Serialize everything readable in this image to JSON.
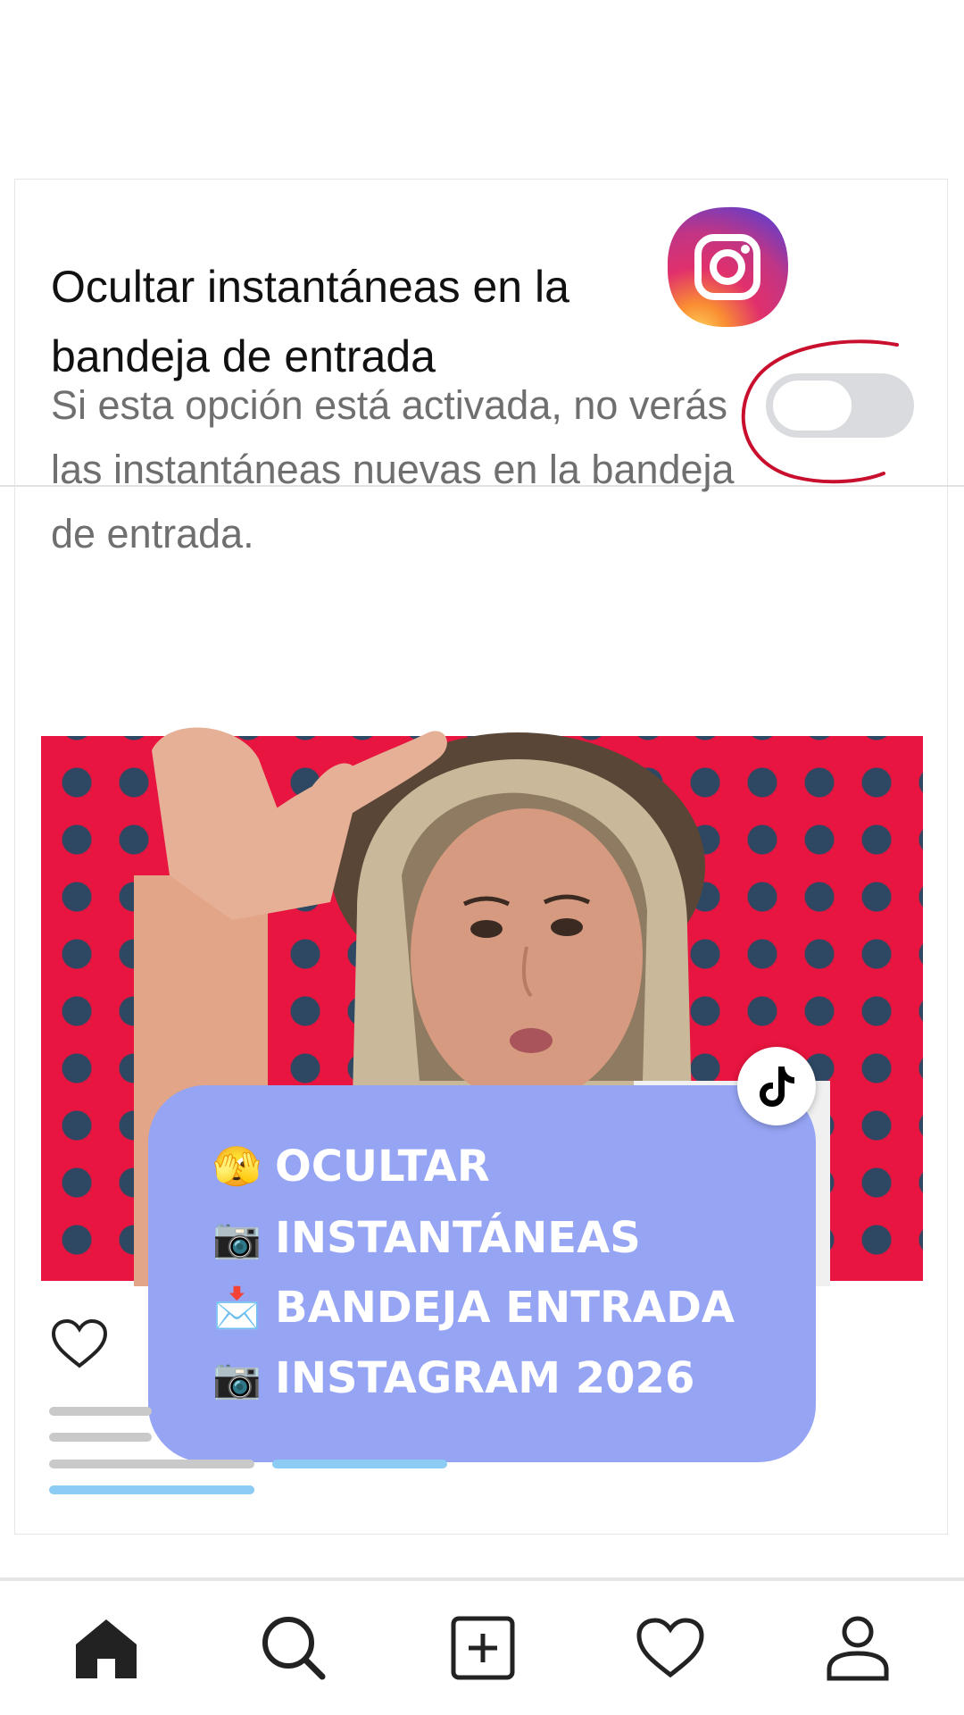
{
  "setting": {
    "title": "Ocultar instantáneas en la bandeja de entrada",
    "description": "Si esta opción está activada, no verás las instantáneas nuevas en la bandeja de entrada.",
    "toggle_on": false
  },
  "overlay": {
    "lines": [
      {
        "emoji": "🫣",
        "text": "OCULTAR"
      },
      {
        "emoji": "📷",
        "text": "INSTANTÁNEAS"
      },
      {
        "emoji": "📩",
        "text": "BANDEJA ENTRADA"
      },
      {
        "emoji": "📷",
        "text": "INSTAGRAM 2026"
      }
    ]
  },
  "icons": {
    "brand_logo": "instagram-logo",
    "badge": "tiktok-icon",
    "annotation": "red-circle-annotation",
    "post_like": "heart-icon"
  },
  "tabbar": {
    "items": [
      "home-icon",
      "search-icon",
      "add-post-icon",
      "heart-icon",
      "profile-icon"
    ]
  },
  "colors": {
    "overlay_bg": "#96a4f4",
    "photo_bg": "#e7153f",
    "dots": "#2e4864",
    "annotation": "#c8102e",
    "toggle_off": "#d9dbde",
    "link_bar": "#8ccbf3"
  }
}
